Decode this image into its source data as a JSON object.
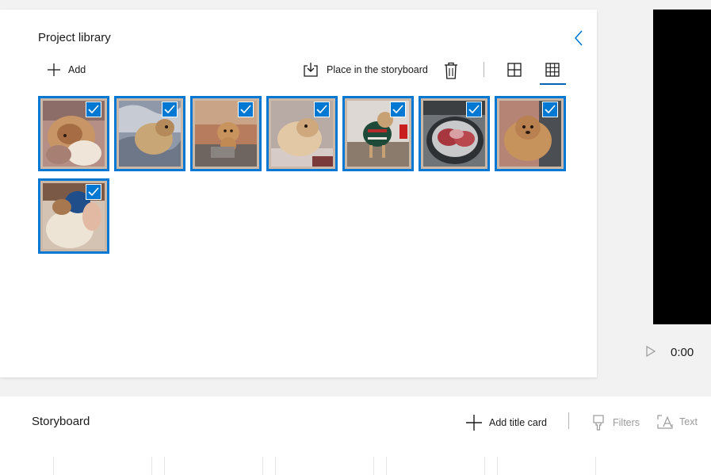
{
  "library": {
    "title": "Project library",
    "add_label": "Add",
    "place_label": "Place in the storyboard",
    "icons": {
      "collapse": "chevron-left-icon",
      "add": "plus-icon",
      "place": "place-in-storyboard-icon",
      "delete": "trash-icon",
      "large_view": "large-grid-icon",
      "small_view": "small-grid-icon"
    },
    "selected_view": "small-grid",
    "thumbnails": [
      {
        "subject": "dog lying on back",
        "selected": true
      },
      {
        "subject": "dog on blanket",
        "selected": true
      },
      {
        "subject": "dog sitting on couch",
        "selected": true
      },
      {
        "subject": "dog on bed",
        "selected": true
      },
      {
        "subject": "dog in christmas sweater",
        "selected": true
      },
      {
        "subject": "meat in slow cooker",
        "selected": true
      },
      {
        "subject": "dog on sofa",
        "selected": true
      },
      {
        "subject": "dog with blue ball",
        "selected": true
      }
    ]
  },
  "player": {
    "time": "0:00",
    "play_icon": "play-icon"
  },
  "storyboard": {
    "title": "Storyboard",
    "add_title_card_label": "Add title card",
    "filters_label": "Filters",
    "text_label": "Text"
  },
  "colors": {
    "accent": "#0078d4",
    "accent_dark": "#0063b1",
    "disabled_text": "#9a9a9a"
  }
}
